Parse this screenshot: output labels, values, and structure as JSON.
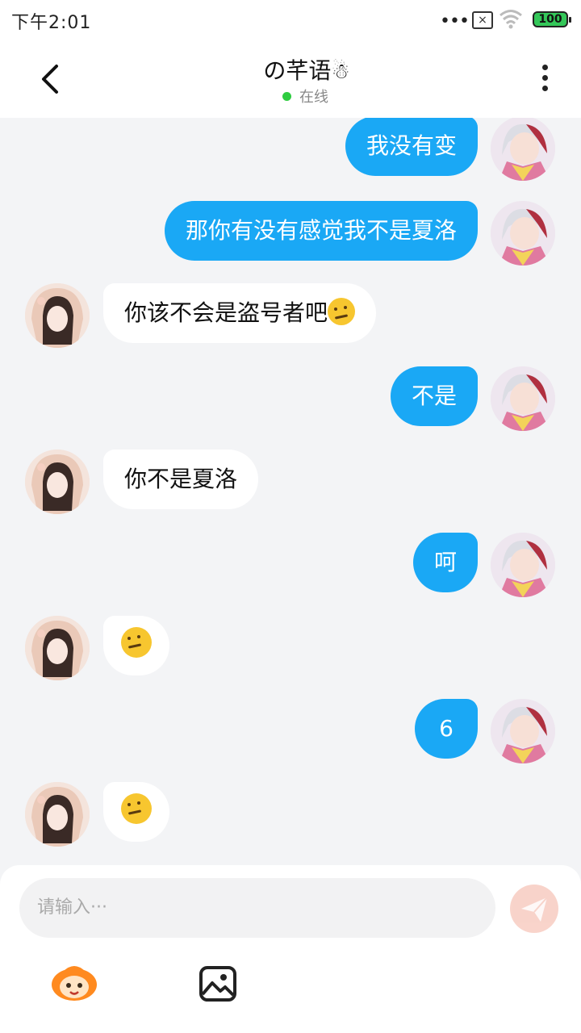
{
  "status_bar": {
    "time": "下午2:01",
    "dots": "•••",
    "battery": "100"
  },
  "header": {
    "title": "の芊语",
    "title_emoji": "☃",
    "status": "在线"
  },
  "messages": [
    {
      "side": "self",
      "text": "我没有变"
    },
    {
      "side": "self",
      "text": "那你有没有感觉我不是夏洛"
    },
    {
      "side": "peer",
      "text": "你该不会是盗号者吧"
    },
    {
      "side": "self",
      "text": "不是"
    },
    {
      "side": "peer",
      "text": "你不是夏洛"
    },
    {
      "side": "self",
      "text": "呵"
    },
    {
      "side": "peer",
      "text": ""
    },
    {
      "side": "self",
      "text": "6"
    },
    {
      "side": "peer",
      "text": ""
    }
  ],
  "composer": {
    "placeholder": "请输入···"
  },
  "colors": {
    "self_bubble": "#1aa8f5",
    "peer_bubble": "#ffffff",
    "online_dot": "#2ecc40",
    "send_button": "#f8cfc5"
  }
}
